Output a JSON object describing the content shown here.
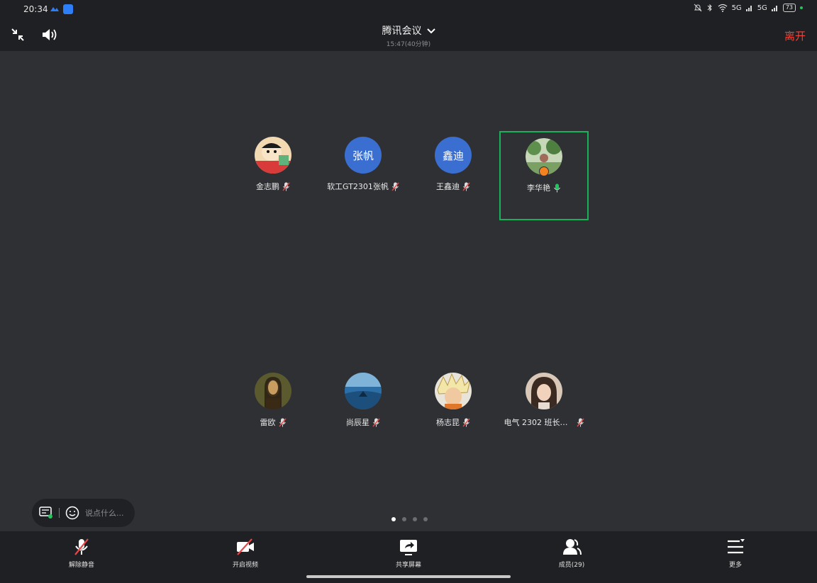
{
  "status_bar": {
    "time": "20:34",
    "battery": "73",
    "signal_1": "5G",
    "signal_2": "5G"
  },
  "header": {
    "title": "腾讯会议",
    "duration": "15:47(40分钟)",
    "leave_label": "离开"
  },
  "participants": [
    {
      "name": "金志鹏",
      "initials": "",
      "muted": true
    },
    {
      "name": "软工GT2301张帆",
      "initials": "张帆",
      "muted": true
    },
    {
      "name": "王鑫迪",
      "initials": "鑫迪",
      "muted": true
    },
    {
      "name": "李华艳",
      "initials": "",
      "muted": false,
      "speaking": true,
      "host": true
    },
    {
      "name": "雷欧",
      "initials": "",
      "muted": true
    },
    {
      "name": "尚辰星",
      "initials": "",
      "muted": true
    },
    {
      "name": "杨志昆",
      "initials": "",
      "muted": true
    },
    {
      "name": "电气 2302 班长…",
      "initials": "",
      "muted": true
    }
  ],
  "chat": {
    "placeholder": "说点什么..."
  },
  "pagination": {
    "pages": 4,
    "current": 1
  },
  "toolbar": {
    "unmute_label": "解除静音",
    "video_label": "开启视频",
    "share_label": "共享屏幕",
    "members_label": "成员(29)",
    "more_label": "更多"
  },
  "colors": {
    "background": "#2e3034",
    "bar": "#1f2023",
    "leave": "#f04438",
    "speaking_border": "#16b35a",
    "avatar_text_bg": "#3a6fd1",
    "mic_muted": "#e54848",
    "mic_active": "#22c55e"
  }
}
